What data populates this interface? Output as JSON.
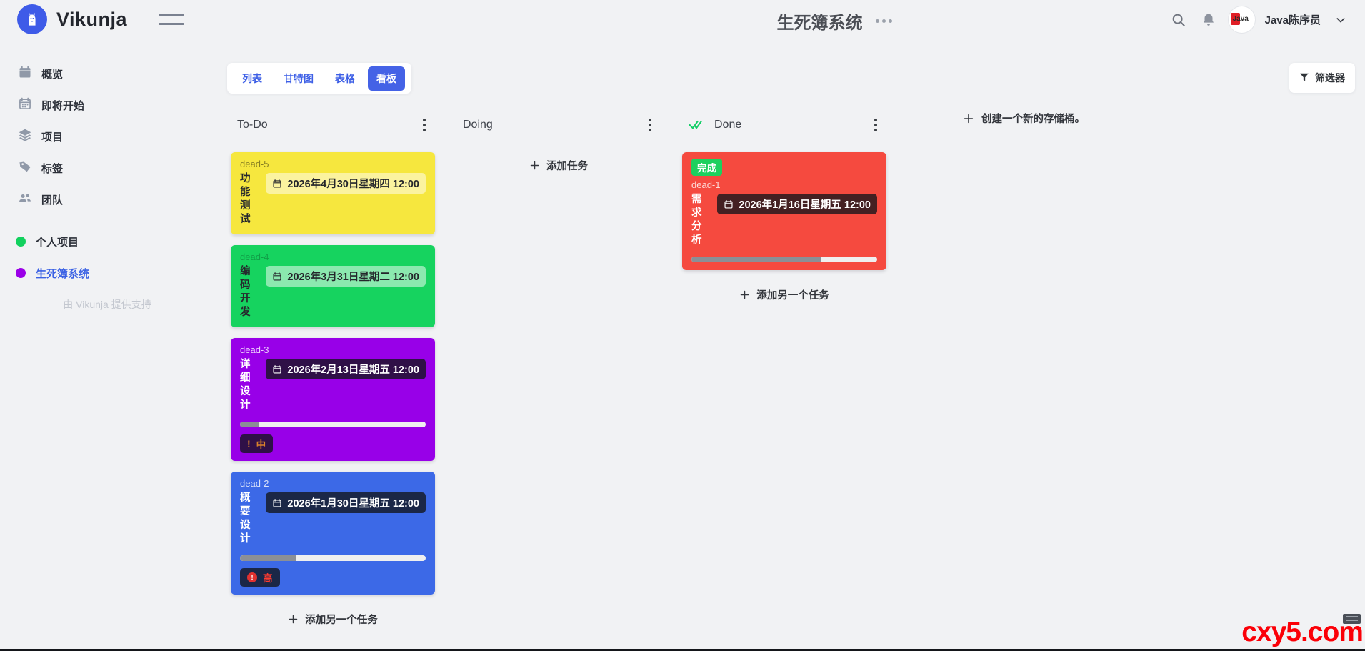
{
  "topbar": {
    "logo_text": "Vikunja",
    "title": "生死簿系统",
    "user_name": "Java陈序员",
    "avatar_text": "Java"
  },
  "sidebar": {
    "items": [
      {
        "label": "概览",
        "icon": "calendar-icon"
      },
      {
        "label": "即将开始",
        "icon": "upcoming-calendar-icon"
      },
      {
        "label": "项目",
        "icon": "layers-icon"
      },
      {
        "label": "标签",
        "icon": "tag-icon"
      },
      {
        "label": "团队",
        "icon": "users-icon"
      }
    ],
    "projects": [
      {
        "label": "个人项目",
        "dot": "#12d15e",
        "active": false
      },
      {
        "label": "生死簿系统",
        "dot": "#9b00e8",
        "active": true
      }
    ],
    "powered_by": "由 Vikunja 提供支持"
  },
  "views": {
    "tabs": [
      {
        "label": "列表",
        "active": false
      },
      {
        "label": "甘特图",
        "active": false
      },
      {
        "label": "表格",
        "active": false
      },
      {
        "label": "看板",
        "active": true
      }
    ],
    "filter_label": "筛选器",
    "accent_color": "#4462e6"
  },
  "board": {
    "buckets": [
      {
        "title": "To-Do",
        "add_label": "添加另一个任务",
        "cards": [
          {
            "id": "dead-5",
            "title": "功能测试",
            "due": "2026年4月30日星期四 12:00",
            "color": "#f6e73e"
          },
          {
            "id": "dead-4",
            "title": "编码开发",
            "due": "2026年3月31日星期二 12:00",
            "color": "#16d35f"
          },
          {
            "id": "dead-3",
            "title": "详细设计",
            "due": "2026年2月13日星期五 12:00",
            "color": "#9800e8",
            "progress": 10,
            "priority": "中"
          },
          {
            "id": "dead-2",
            "title": "概要设计",
            "due": "2026年1月30日星期五 12:00",
            "color": "#3c69e7",
            "progress": 30,
            "priority": "高"
          }
        ]
      },
      {
        "title": "Doing",
        "add_label": "添加任务",
        "cards": []
      },
      {
        "title": "Done",
        "add_label": "添加另一个任务",
        "cards": [
          {
            "id": "dead-1",
            "title": "需求分析",
            "due": "2026年1月16日星期五 12:00",
            "color": "#f54a3f",
            "progress": 70,
            "done_label": "完成"
          }
        ]
      }
    ],
    "create_bucket_label": "创建一个新的存储桶。"
  },
  "watermark": "cxy5.com"
}
